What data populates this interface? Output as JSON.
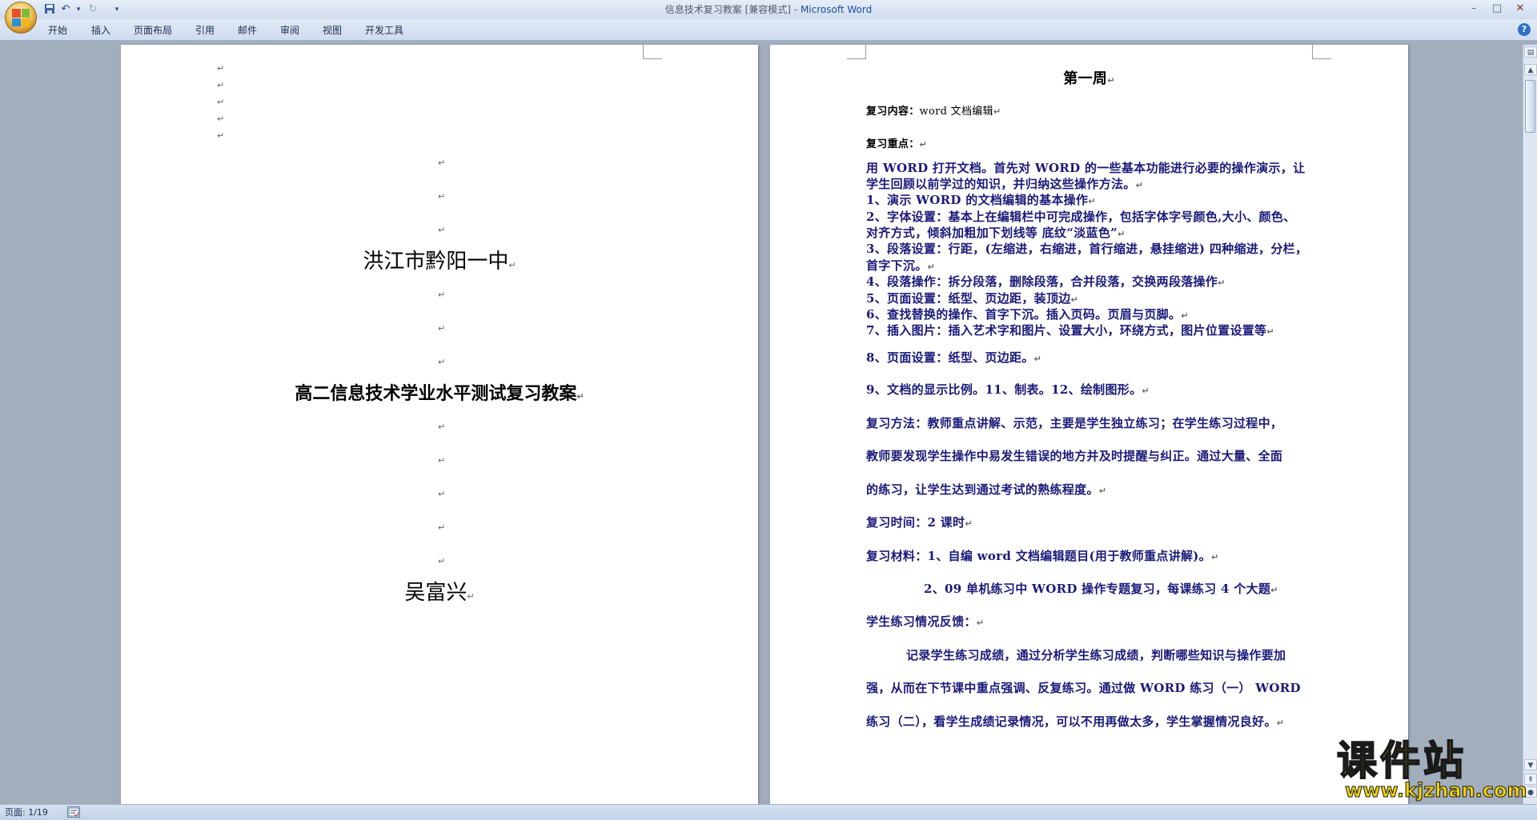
{
  "window": {
    "doc_name": "信息技术复习教案 [兼容模式]",
    "separator": " - ",
    "app_name": "Microsoft Word"
  },
  "ribbon": {
    "tabs": [
      "开始",
      "插入",
      "页面布局",
      "引用",
      "邮件",
      "审阅",
      "视图",
      "开发工具"
    ]
  },
  "page_left": {
    "school": "洪江市黔阳一中",
    "doc_title": "高二信息技术学业水平测试复习教案",
    "author": "吴富兴"
  },
  "page_right": {
    "heading": "第一周",
    "content_label": "复习内容：",
    "content_value": "word 文档编辑",
    "focus_label": "复习重点：",
    "lines": [
      "用 WORD 打开文档。首先对 WORD 的一些基本功能进行必要的操作演示，让",
      "学生回顾以前学过的知识，并归纳这些操作方法。",
      "1、演示 WORD 的文档编辑的基本操作",
      "2、字体设置：基本上在编辑栏中可完成操作，包括字体字号颜色,大小、颜色、",
      "对齐方式，倾斜加粗加下划线等   底纹“淡蓝色”",
      "3、段落设置：行距，(左缩进，右缩进，首行缩进，悬挂缩进) 四种缩进，分栏，",
      "首字下沉。",
      "4、段落操作：拆分段落，删除段落，合并段落，交换两段落操作",
      "5、页面设置：纸型、页边距，装顶边",
      "6、查找替换的操作、首字下沉。插入页码。页眉与页脚。",
      "7、插入图片：插入艺术字和图片、设置大小，环绕方式，图片位置设置等",
      "8、页面设置：纸型、页边距。",
      "9、文档的显示比例。11、制表。12、绘制图形。",
      "复习方法：教师重点讲解、示范，主要是学生独立练习；在学生练习过程中，",
      "教师要发现学生操作中易发生错误的地方并及时提醒与纠正。通过大量、全面",
      "的练习，让学生达到通过考试的熟练程度。",
      "复习时间：2 课时",
      "复习材料：1、自编 word 文档编辑题目(用于教师重点讲解)。",
      "2、09 单机练习中 WORD 操作专题复习，每课练习 4 个大题",
      "学生练习情况反馈：",
      "记录学生练习成绩，通过分析学生练习成绩，判断哪些知识与操作要加",
      "强，从而在下节课中重点强调、反复练习。通过做 WORD 练习（一）  WORD",
      "练习（二），看学生成绩记录情况，可以不用再做太多，学生掌握情况良好。"
    ]
  },
  "statusbar": {
    "page_info": "页面: 1/19"
  },
  "watermark": {
    "brand": "课件站",
    "url": "www.kjzhan.com"
  },
  "icons": [
    "office-button-icon",
    "save-icon",
    "undo-icon",
    "redo-icon",
    "customize-qat-icon",
    "minimize-icon",
    "maximize-icon",
    "close-icon",
    "help-icon",
    "scroll-up-icon",
    "scroll-down-icon",
    "spell-check-icon"
  ]
}
